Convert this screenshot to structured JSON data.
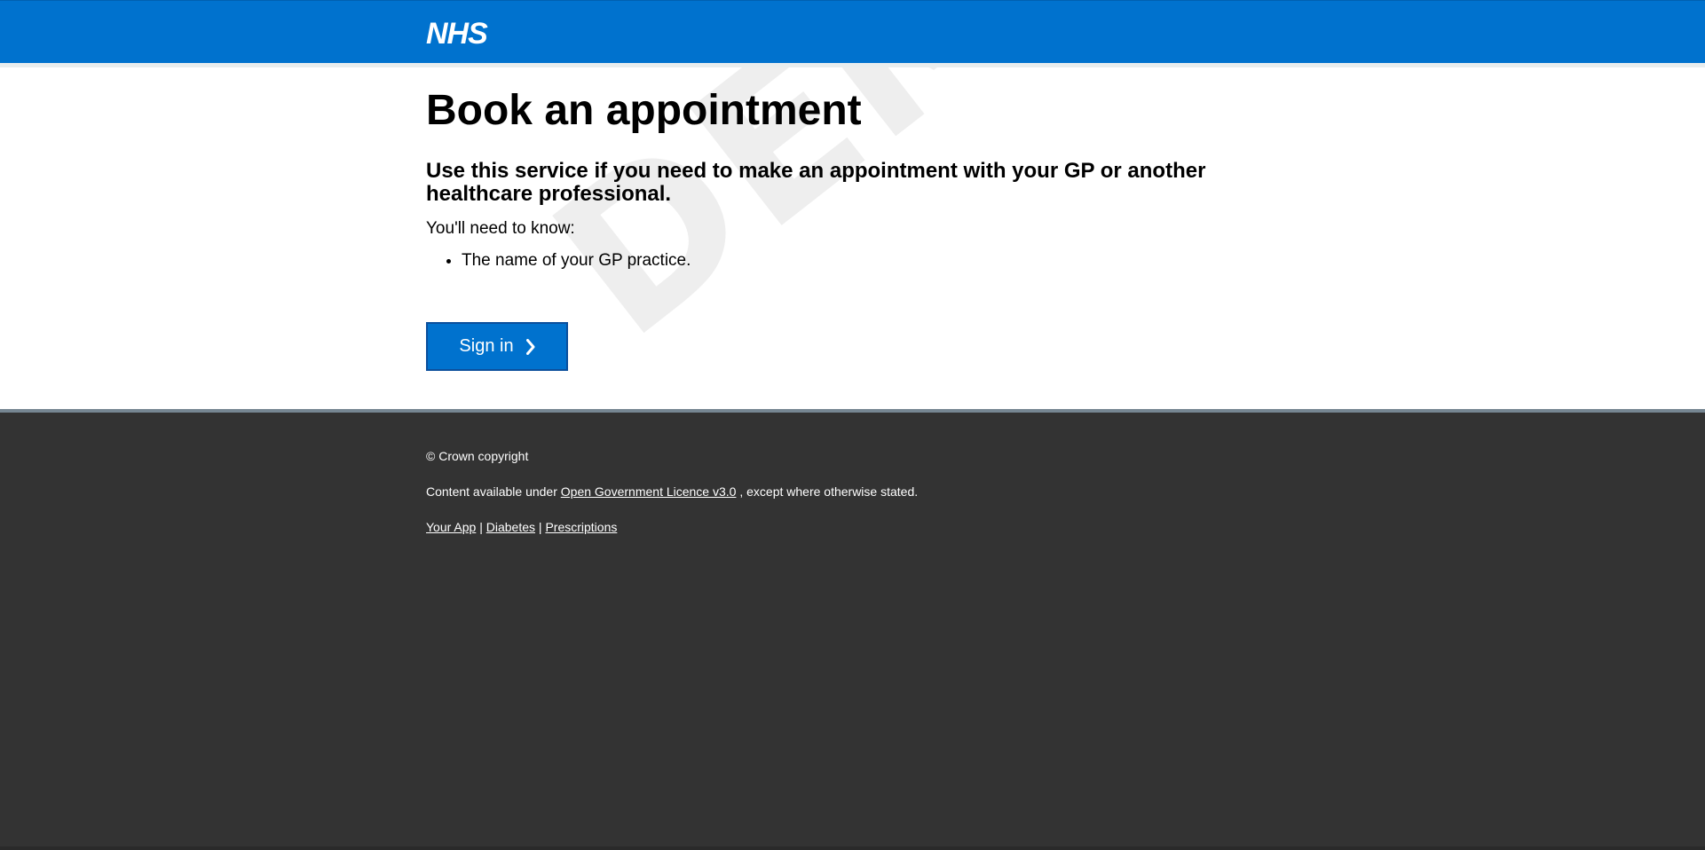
{
  "header": {
    "logo_text": "NHS",
    "brand_color": "#0072ce"
  },
  "watermark": {
    "text": "DEMO"
  },
  "main": {
    "title": "Book an appointment",
    "lede": "Use this service if you need to make an appointment with your GP or another healthcare professional.",
    "need_text": "You'll need to know:",
    "need_items": [
      "The name of your GP practice."
    ],
    "sign_in_label": "Sign in",
    "sign_in_icon": "chevron-right-icon"
  },
  "footer": {
    "copyright": "© Crown copyright",
    "licence_prefix": "Content available under ",
    "licence_link": "Open Government Licence v3.0",
    "licence_suffix": " , except where otherwise stated.",
    "links": [
      "Your App",
      "Diabetes",
      "Prescriptions"
    ],
    "separator": "|",
    "background_color": "#333333"
  }
}
